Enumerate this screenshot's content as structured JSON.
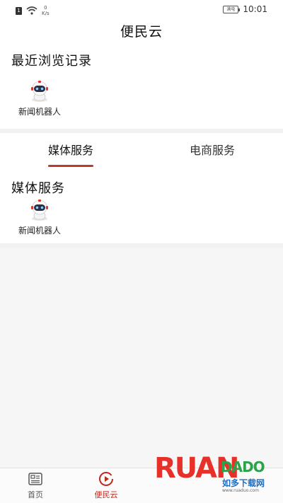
{
  "status_bar": {
    "sim_glyph": "1",
    "network_speed_value": "0",
    "network_speed_unit": "K/s",
    "battery_label": "满电",
    "time": "10:01"
  },
  "header": {
    "title": "便民云"
  },
  "recent": {
    "heading": "最近浏览记录",
    "items": [
      {
        "label": "新闻机器人",
        "icon": "robot-icon"
      }
    ]
  },
  "tabs": [
    {
      "label": "媒体服务",
      "active": true
    },
    {
      "label": "电商服务",
      "active": false
    }
  ],
  "services": {
    "heading": "媒体服务",
    "items": [
      {
        "label": "新闻机器人",
        "icon": "robot-icon"
      }
    ]
  },
  "bottom_nav": [
    {
      "label": "首页",
      "icon": "newspaper-icon",
      "active": false
    },
    {
      "label": "便民云",
      "icon": "play-circle-icon",
      "active": true
    }
  ],
  "watermark": {
    "brand_main": "RUAN",
    "brand_alt": "DADO",
    "tagline": "如多下载网",
    "url": "www.ruaduo.com"
  },
  "colors": {
    "accent": "#c0392b",
    "nav_active": "#c0281e",
    "background": "#f3f3f3"
  }
}
